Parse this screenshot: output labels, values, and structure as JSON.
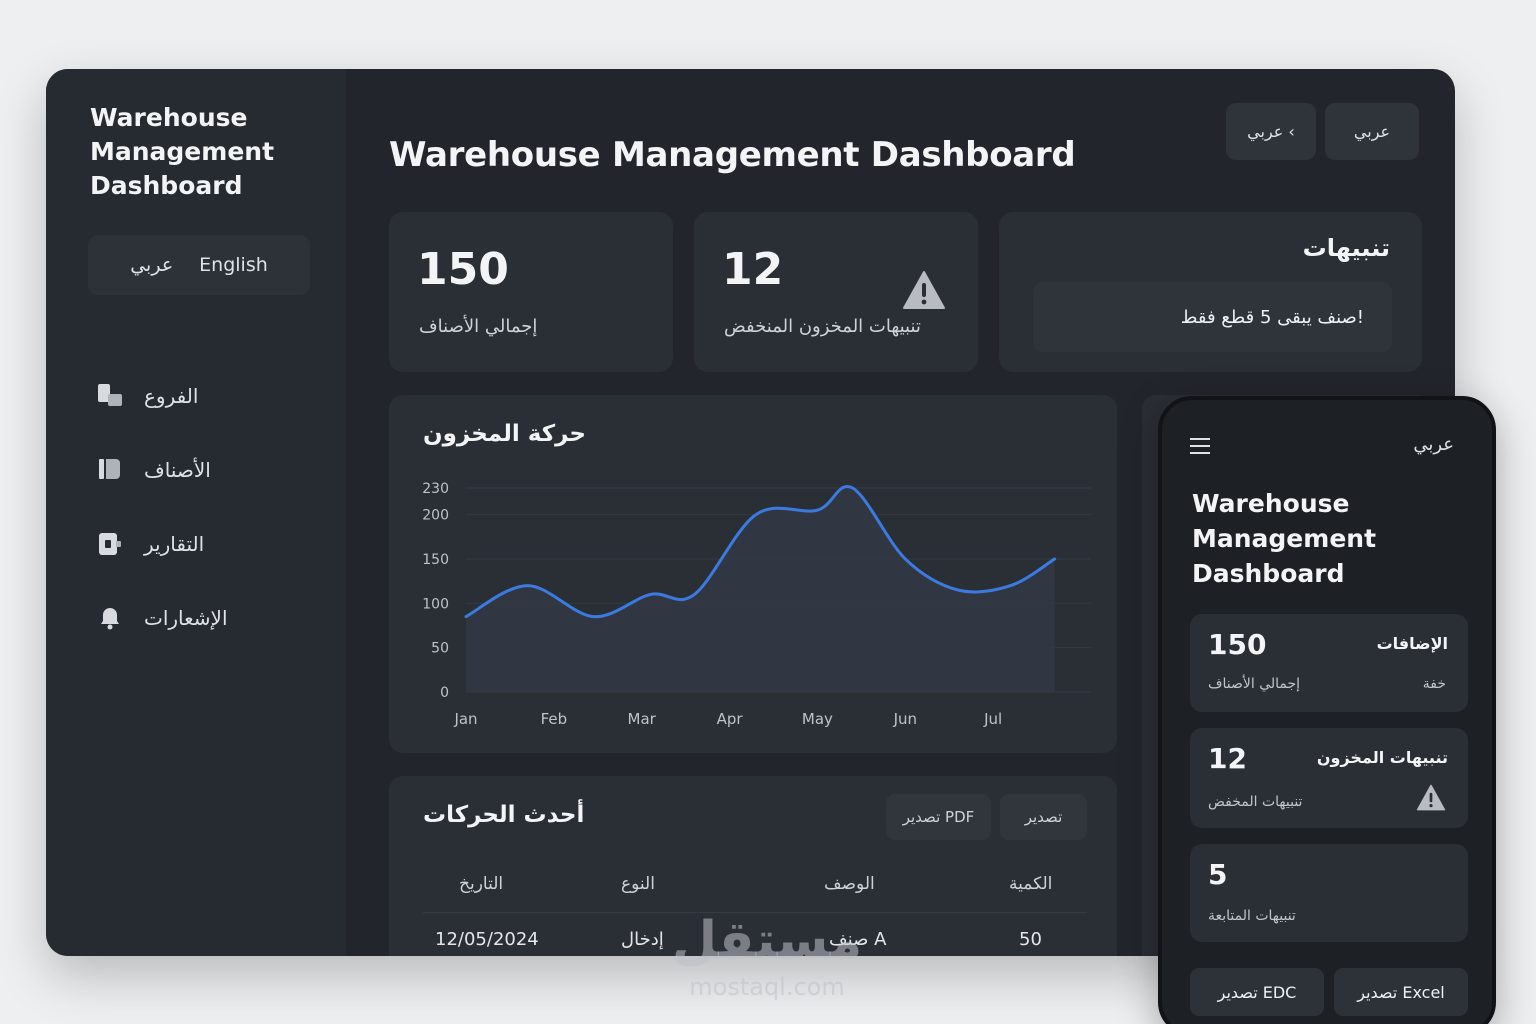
{
  "sidebar": {
    "title": "Warehouse Management Dashboard",
    "lang_arabic": "عربي",
    "lang_english": "English",
    "items": [
      {
        "label": "الفروع",
        "icon": "branches-icon"
      },
      {
        "label": "الأصناف",
        "icon": "items-icon"
      },
      {
        "label": "التقارير",
        "icon": "reports-icon"
      },
      {
        "label": "الإشعارات",
        "icon": "bell-icon"
      }
    ]
  },
  "header": {
    "title": "Warehouse Management Dashboard",
    "btn_lang_dropdown": "عربي ‹",
    "btn_lang": "عربي"
  },
  "stats": {
    "total_items": {
      "value": "150",
      "label": "إجمالي الأصناف"
    },
    "low_stock": {
      "value": "12",
      "label": "تنبيهات المخزون المنخفض"
    }
  },
  "alerts": {
    "title": "تنبيهات",
    "items": [
      "صنف يبقى 5 قطع فقط!"
    ]
  },
  "chart_data": {
    "type": "area",
    "title": "حركة المخزون",
    "categories": [
      "Jan",
      "Feb",
      "Mar",
      "Apr",
      "May",
      "Jun",
      "Jul"
    ],
    "x": [
      0,
      1,
      2,
      3,
      4,
      5,
      6
    ],
    "values_x": [
      0,
      0.7,
      1.45,
      2.1,
      2.6,
      3.3,
      4.0,
      4.4,
      5.0,
      5.6,
      6.2,
      6.7
    ],
    "values": [
      85,
      120,
      85,
      110,
      110,
      200,
      205,
      230,
      150,
      115,
      120,
      150
    ],
    "yticks": [
      0,
      50,
      100,
      150,
      200,
      230
    ],
    "ylim": [
      0,
      230
    ],
    "grid": true,
    "line_color": "#3b7be0"
  },
  "table": {
    "title": "أحدث الحركات",
    "btn_pdf": "تصدير PDF",
    "btn_export": "تصدير",
    "headers": [
      "التاريخ",
      "النوع",
      "الوصف",
      "الكمية"
    ],
    "rows": [
      [
        "12/05/2024",
        "إدخال",
        "صنف A",
        "50"
      ]
    ]
  },
  "mobile": {
    "lang": "عربي",
    "title": "Warehouse Management Dashboard",
    "cards": [
      {
        "value": "150",
        "sub": "إجمالي الأصناف",
        "right_title": "الإضافات",
        "right_sub": "خفة"
      },
      {
        "value": "12",
        "sub": "تنبيهات المخفض",
        "right_title": "تنبيهات المخزون",
        "right_sub": ""
      },
      {
        "value": "5",
        "sub": "تنبيهات المتابعة",
        "right_title": "",
        "right_sub": ""
      }
    ],
    "btn_excel": "تصدير Excel",
    "btn_edc": "تصدير EDC"
  },
  "watermark": {
    "arabic": "مستقل",
    "latin": "mostaql.com"
  }
}
